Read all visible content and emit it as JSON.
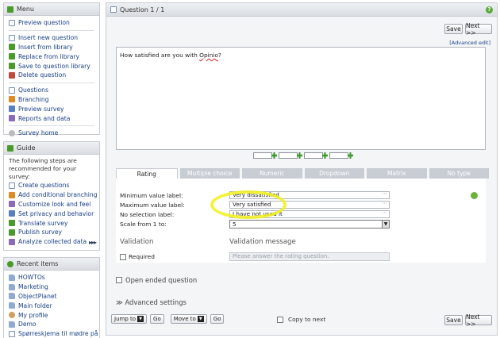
{
  "menu": {
    "title": "Menu",
    "items": [
      {
        "label": "Preview question",
        "icon": "preview-icon"
      },
      {
        "label": "Insert new question",
        "icon": "insert-icon"
      },
      {
        "label": "Insert from library",
        "icon": "library-icon"
      },
      {
        "label": "Replace from library",
        "icon": "replace-icon"
      },
      {
        "label": "Save to question library",
        "icon": "save-library-icon"
      },
      {
        "label": "Delete question",
        "icon": "delete-icon"
      },
      {
        "label": "Questions",
        "icon": "questions-icon"
      },
      {
        "label": "Branching",
        "icon": "branching-icon"
      },
      {
        "label": "Preview survey",
        "icon": "preview-survey-icon"
      },
      {
        "label": "Reports and data",
        "icon": "reports-icon"
      },
      {
        "label": "Survey home",
        "icon": "home-icon"
      }
    ]
  },
  "guide": {
    "title": "Guide",
    "intro": "The following steps are recommended for your survey:",
    "steps": [
      "Create questions",
      "Add conditional branching",
      "Customize look and feel",
      "Set privacy and behavior",
      "Translate survey",
      "Publish survey",
      "Analyze collected data"
    ],
    "more": "▸▸▸"
  },
  "recent": {
    "title": "Recent items",
    "items": [
      "HOWTOs",
      "Marketing",
      "ObjectPlanet",
      "Main folder",
      "My profile",
      "Demo",
      "Spørreskjema til mødre på"
    ]
  },
  "main": {
    "title": "Question 1 / 1",
    "save_label": "Save",
    "next_label": "Next >>",
    "advanced_edit": "[Advanced edit]",
    "question_text_pre": "How satisfied are you with ",
    "question_text_word": "Opinio",
    "question_text_post": "?",
    "tabs": [
      "Rating",
      "Multiple choice",
      "Numeric",
      "Dropdown",
      "Matrix",
      "No type"
    ],
    "fields": {
      "min_label": "Minimum value label:",
      "min_value": "Very dissatisfied",
      "max_label": "Maximum value label:",
      "max_value": "Very satisfied",
      "nosel_label": "No selection label:",
      "nosel_value": "I have not used it",
      "scale_label": "Scale from 1 to:",
      "scale_value": "5"
    },
    "validation_title": "Validation",
    "validation_message_title": "Validation message",
    "required_label": "Required",
    "validation_placeholder": "Please answer the rating question.",
    "open_ended_label": "Open ended question",
    "advanced_settings_label": "Advanced settings",
    "jump_to_label": "Jump to",
    "go_label": "Go",
    "move_to_label": "Move to",
    "copy_next_label": "Copy to next"
  },
  "colors": {
    "highlight": "#f1f11a",
    "link": "#1a3f87",
    "tab_inactive": "#c8ccd3"
  }
}
